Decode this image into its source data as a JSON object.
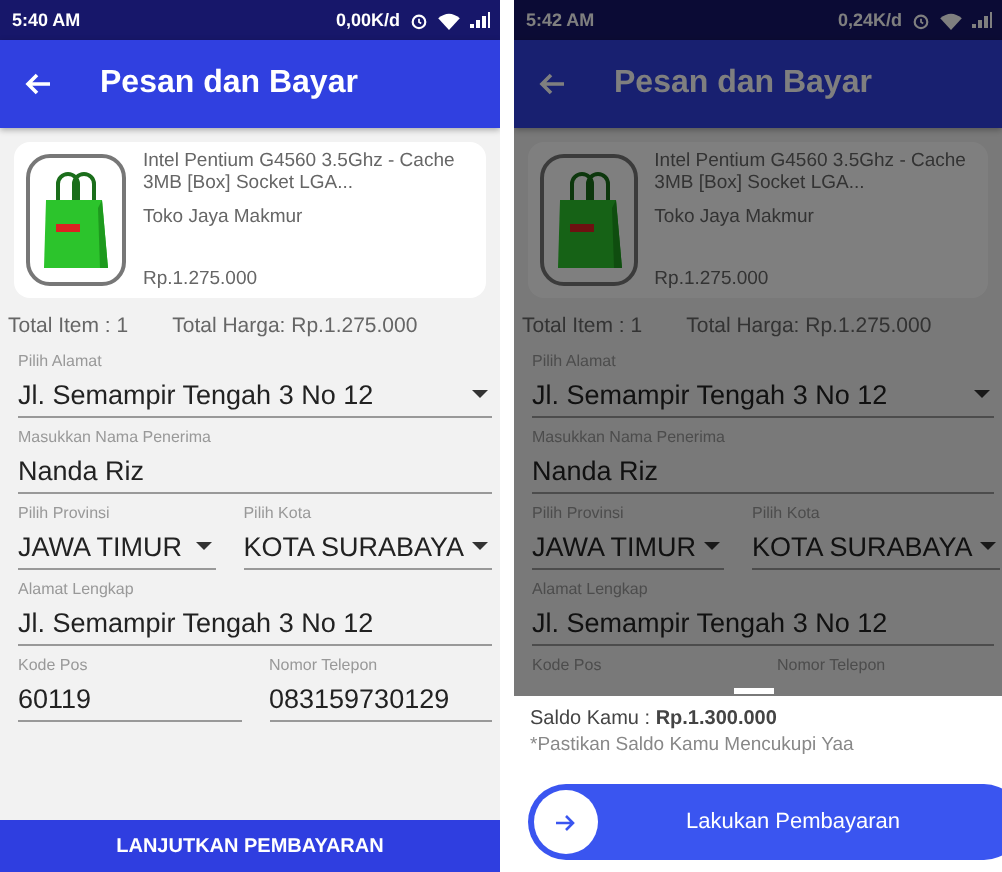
{
  "screens": [
    {
      "status_bar": {
        "time": "5:40 AM",
        "speed": "0,00K/d"
      },
      "app_bar": {
        "title": "Pesan dan Bayar"
      },
      "product": {
        "name": "Intel Pentium G4560 3.5Ghz - Cache 3MB [Box] Socket LGA...",
        "store": "Toko Jaya Makmur",
        "price": "Rp.1.275.000"
      },
      "total_item": "Total Item : 1",
      "total_price": "Total Harga: Rp.1.275.000",
      "field_rows": [
        [
          {
            "kind": "dropdown",
            "label": "Pilih Alamat",
            "value": "Jl. Semampir Tengah 3 No 12"
          }
        ],
        [
          {
            "kind": "text",
            "label": "Masukkan Nama Penerima",
            "value": "Nanda Riz"
          }
        ],
        [
          {
            "kind": "dropdown",
            "label": "Pilih Provinsi",
            "value": "JAWA TIMUR"
          },
          {
            "kind": "dropdown",
            "label": "Pilih Kota",
            "value": "KOTA SURABAYA"
          }
        ],
        [
          {
            "kind": "text",
            "label": "Alamat Lengkap",
            "value": "Jl. Semampir Tengah 3 No 12"
          }
        ],
        [
          {
            "kind": "text",
            "label": "Kode Pos",
            "value": "60119"
          },
          {
            "kind": "text",
            "label": "Nomor Telepon",
            "value": "083159730129"
          }
        ]
      ],
      "dimmed": false,
      "submit_button": "LANJUTKAN PEMBAYARAN"
    },
    {
      "status_bar": {
        "time": "5:42 AM",
        "speed": "0,24K/d"
      },
      "app_bar": {
        "title": "Pesan dan Bayar"
      },
      "product": {
        "name": "Intel Pentium G4560 3.5Ghz - Cache 3MB [Box] Socket LGA...",
        "store": "Toko Jaya Makmur",
        "price": "Rp.1.275.000"
      },
      "total_item": "Total Item : 1",
      "total_price": "Total Harga: Rp.1.275.000",
      "field_rows": [
        [
          {
            "kind": "dropdown",
            "label": "Pilih Alamat",
            "value": "Jl. Semampir Tengah 3 No 12"
          }
        ],
        [
          {
            "kind": "text",
            "label": "Masukkan Nama Penerima",
            "value": "Nanda Riz"
          }
        ],
        [
          {
            "kind": "dropdown",
            "label": "Pilih Provinsi",
            "value": "JAWA TIMUR"
          },
          {
            "kind": "dropdown",
            "label": "Pilih Kota",
            "value": "KOTA SURABAYA"
          }
        ],
        [
          {
            "kind": "text",
            "label": "Alamat Lengkap",
            "value": "Jl. Semampir Tengah 3 No 12"
          }
        ],
        [
          {
            "kind": "text",
            "label": "Kode Pos"
          },
          {
            "kind": "text",
            "label": "Nomor Telepon"
          }
        ]
      ],
      "dimmed": true,
      "bottom_sheet": {
        "balance": "Saldo Kamu : **Rp.1.300.000**",
        "note": "*Pastikan Saldo Kamu Mencukupi Yaa",
        "pay_button": "Lakukan Pembayaran"
      }
    }
  ]
}
